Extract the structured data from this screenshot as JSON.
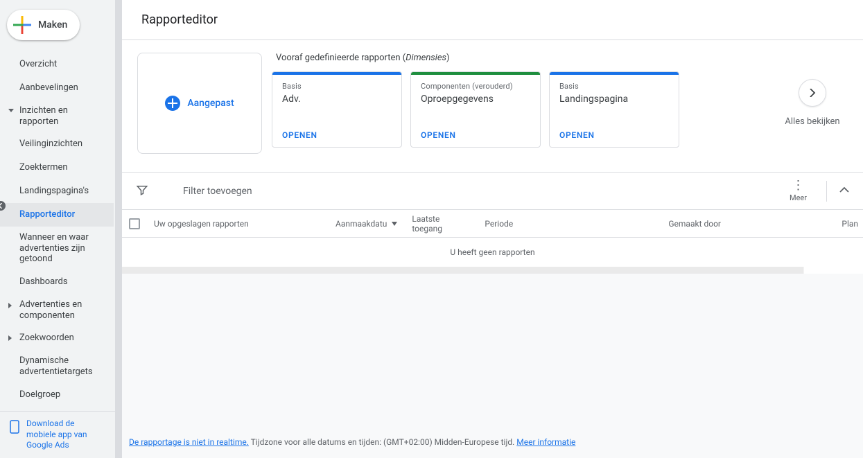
{
  "create_button": "Maken",
  "sidebar": {
    "items": [
      {
        "label": "Overzicht"
      },
      {
        "label": "Aanbevelingen"
      },
      {
        "label": "Inzichten en rapporten"
      },
      {
        "label": "Veilinginzichten"
      },
      {
        "label": "Zoektermen"
      },
      {
        "label": "Landingspagina's"
      },
      {
        "label": "Rapporteditor"
      },
      {
        "label": "Wanneer en waar advertenties zijn getoond"
      },
      {
        "label": "Dashboards"
      },
      {
        "label": "Advertenties en componenten"
      },
      {
        "label": "Zoekwoorden"
      },
      {
        "label": "Dynamische advertentietargets"
      },
      {
        "label": "Doelgroep"
      }
    ]
  },
  "download_link": "Download de mobiele app van Google Ads",
  "page_title": "Rapporteditor",
  "custom_card_label": "Aangepast",
  "predefined_header_prefix": "Vooraf gedefinieerde rapporten (",
  "predefined_header_em": "Dimensies",
  "predefined_header_suffix": ")",
  "cards": [
    {
      "color": "#1a73e8",
      "category": "Basis",
      "name": "Adv.",
      "open": "OPENEN"
    },
    {
      "color": "#1e8e3e",
      "category": "Componenten (verouderd)",
      "name": "Oproepgegevens",
      "open": "OPENEN"
    },
    {
      "color": "#1a73e8",
      "category": "Basis",
      "name": "Landingspagina",
      "open": "OPENEN"
    }
  ],
  "view_all": "Alles bekijken",
  "filter_label": "Filter toevoegen",
  "more_label": "Meer",
  "table": {
    "headers": {
      "saved": "Uw opgeslagen rapporten",
      "created": "Aanmaakdatu",
      "last_access": "Laatste toegang",
      "period": "Periode",
      "made_by": "Gemaakt door",
      "plan": "Plan"
    },
    "empty": "U heeft geen rapporten"
  },
  "footer": {
    "link1": "De rapportage is niet in realtime.",
    "text1": " Tijdzone voor alle datums en tijden: (GMT+02:00) Midden-Europese tijd. ",
    "link2": "Meer informatie"
  }
}
